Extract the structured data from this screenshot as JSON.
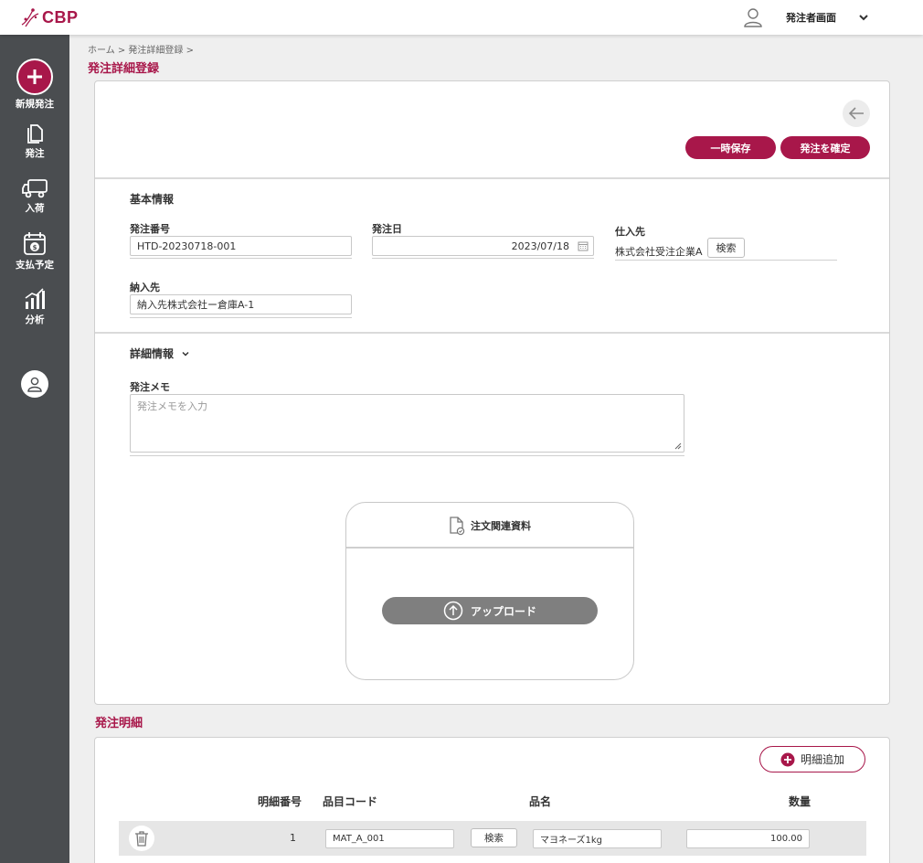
{
  "header": {
    "logo_text": "CBP",
    "user_label": "発注者画面"
  },
  "sidebar": {
    "items": [
      {
        "label": "新規発注",
        "icon": "plus-circle-icon"
      },
      {
        "label": "発注",
        "icon": "document-icon"
      },
      {
        "label": "入荷",
        "icon": "truck-icon"
      },
      {
        "label": "支払予定",
        "icon": "calendar-dollar-icon"
      },
      {
        "label": "分析",
        "icon": "chart-icon"
      }
    ]
  },
  "breadcrumb": "ホーム > 発注詳細登録 >",
  "page_title": "発注詳細登録",
  "actions": {
    "save_label": "一時保存",
    "confirm_label": "発注を確定"
  },
  "basic_info": {
    "heading": "基本情報",
    "order_number_label": "発注番号",
    "order_number_value": "HTD-20230718-001",
    "order_date_label": "発注日",
    "order_date_value": "2023/07/18",
    "supplier_label": "仕入先",
    "supplier_value": "株式会社受注企業A",
    "supplier_search_label": "検索",
    "delivery_label": "納入先",
    "delivery_value": "納入先株式会社ー倉庫A-1"
  },
  "detail_info": {
    "heading": "詳細情報",
    "memo_label": "発注メモ",
    "memo_placeholder": "発注メモを入力"
  },
  "attachments": {
    "title": "注文関連資料",
    "upload_label": "アップロード"
  },
  "order_lines": {
    "section_title": "発注明細",
    "add_label": "明細追加",
    "columns": [
      "明細番号",
      "品目コード",
      "品名",
      "数量"
    ],
    "rows": [
      {
        "line_no": "1",
        "item_code": "MAT_A_001",
        "search_label": "検索",
        "item_name": "マヨネーズ1kg",
        "quantity": "100.00"
      }
    ]
  },
  "colors": {
    "brand": "#a8174a",
    "sidebar": "#4a4d50",
    "upload_button": "#7f7f7f"
  }
}
